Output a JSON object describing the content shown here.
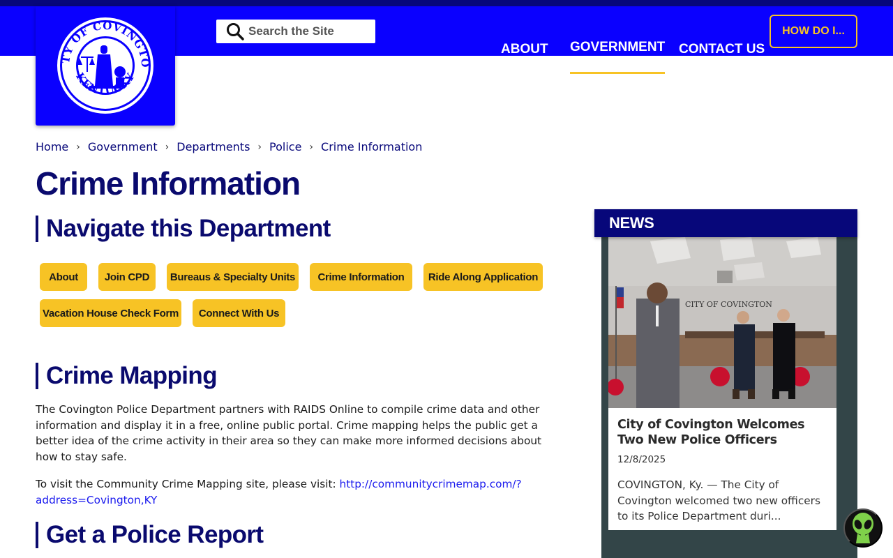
{
  "header": {
    "logo_alt": "City of Covington Kentucky seal",
    "logo_text_top": "CITY OF COVINGTON",
    "logo_text_bottom": "KENTUCKY",
    "search_placeholder": "Search the Site",
    "nav": [
      "ABOUT",
      "GOVERNMENT",
      "CONTACT US"
    ],
    "active_nav": "GOVERNMENT",
    "how_do_i": "HOW DO I..."
  },
  "breadcrumb": [
    "Home",
    "Government",
    "Departments",
    "Police",
    "Crime Information"
  ],
  "page_title": "Crime Information",
  "navigate": {
    "heading": "Navigate this Department",
    "buttons": [
      "About",
      "Join CPD",
      "Bureaus & Specialty Units",
      "Crime Information",
      "Ride Along Application",
      "Vacation House Check Form",
      "Connect With Us"
    ]
  },
  "crime_mapping": {
    "heading": "Crime Mapping",
    "paragraph": "The Covington Police Department partners with RAIDS Online to compile crime data and other information and display it in a free, online public portal. Crime mapping helps the public get a better idea of the crime activity in their area so they can make more informed decisions about how to stay safe.",
    "visit_text": "To visit the Community Crime Mapping site, please visit: ",
    "link": "http://communitycrimemap.com/?address=Covington,KY"
  },
  "police_report": {
    "heading": "Get a Police Report"
  },
  "news": {
    "heading": "NEWS",
    "image_caption": "CITY OF COVINGTON",
    "title": "City of Covington Welcomes Two New Police Officers",
    "date": "12/8/2025",
    "excerpt": "COVINGTON, Ky. — The City of Covington welcomed two new officers to its Police Department duri..."
  },
  "colors": {
    "header_blue": "#0a00ff",
    "navy": "#07077a",
    "gold": "#f7c325",
    "news_bg": "#334548"
  },
  "icons": [
    "search-icon",
    "chevron-right-icon",
    "alien-chat-icon"
  ]
}
